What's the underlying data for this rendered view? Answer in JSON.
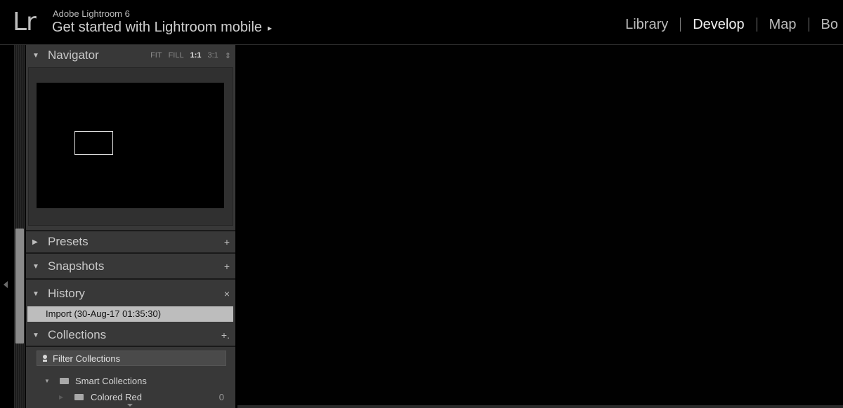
{
  "identity": {
    "logo": "Lr",
    "app_name": "Adobe Lightroom 6",
    "subtitle": "Get started with Lightroom mobile",
    "subtitle_arrow": "▸"
  },
  "modules": [
    {
      "label": "Library",
      "active": false
    },
    {
      "label": "Develop",
      "active": true
    },
    {
      "label": "Map",
      "active": false
    },
    {
      "label": "Bo",
      "active": false
    }
  ],
  "navigator": {
    "title": "Navigator",
    "options": [
      "FIT",
      "FILL",
      "1:1",
      "3:1"
    ],
    "selected_option": "1:1",
    "options_toggle": "⇕"
  },
  "presets": {
    "title": "Presets",
    "add": "+"
  },
  "snapshots": {
    "title": "Snapshots",
    "add": "+"
  },
  "history": {
    "title": "History",
    "clear": "×",
    "items": [
      "Import (30-Aug-17 01:35:30)"
    ]
  },
  "collections": {
    "title": "Collections",
    "add": "+.",
    "filter_placeholder": "Filter Collections",
    "tree": [
      {
        "label": "Smart Collections",
        "count": ""
      },
      {
        "label": "Colored Red",
        "count": "0"
      }
    ]
  },
  "icons": {
    "panel_toggle": "triangle-icon",
    "search": "search-icon",
    "folder": "smart-collection-icon"
  }
}
